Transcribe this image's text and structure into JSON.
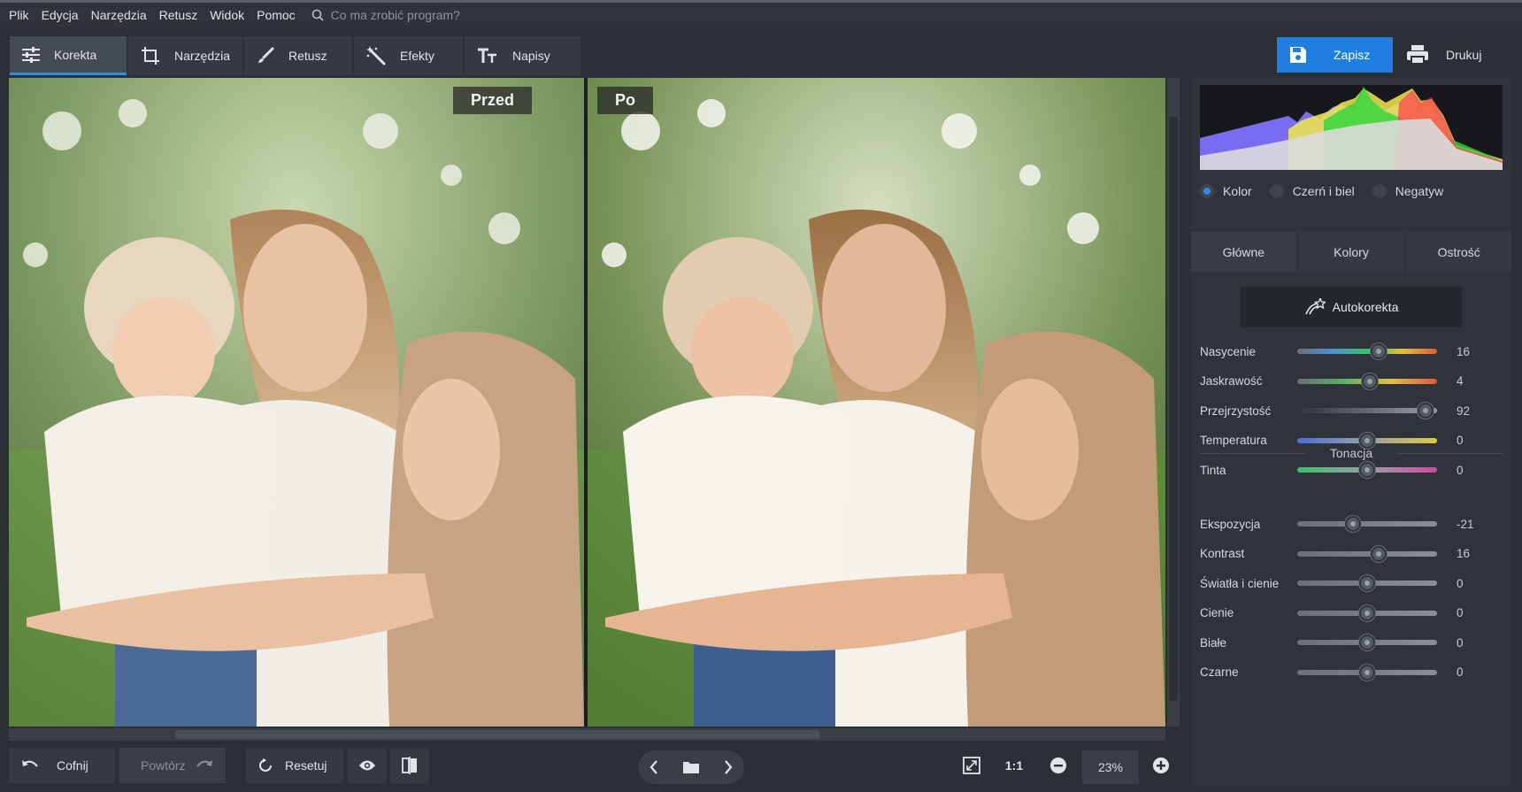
{
  "menu": {
    "items": [
      "Plik",
      "Edycja",
      "Narzędzia",
      "Retusz",
      "Widok",
      "Pomoc"
    ],
    "search_placeholder": "Co ma zrobić program?"
  },
  "toolbar": {
    "tabs": [
      {
        "label": "Korekta",
        "icon": "sliders-icon",
        "active": true
      },
      {
        "label": "Narzędzia",
        "icon": "crop-icon",
        "active": false
      },
      {
        "label": "Retusz",
        "icon": "brush-icon",
        "active": false
      },
      {
        "label": "Efekty",
        "icon": "magic-wand-icon",
        "active": false
      },
      {
        "label": "Napisy",
        "icon": "text-icon",
        "active": false
      }
    ],
    "save_label": "Zapisz",
    "print_label": "Drukuj"
  },
  "preview": {
    "before_label": "Przed",
    "after_label": "Po"
  },
  "panel": {
    "color_modes": [
      {
        "label": "Kolor",
        "selected": true
      },
      {
        "label": "Czerń i biel",
        "selected": false
      },
      {
        "label": "Negatyw",
        "selected": false
      }
    ],
    "tabs": [
      "Główne",
      "Kolory",
      "Ostrość"
    ],
    "active_tab": "Główne",
    "auto_label": "Autokorekta",
    "main_sliders": [
      {
        "label": "Nasycenie",
        "value": "16",
        "level": 0.58,
        "gradient": "saturation"
      },
      {
        "label": "Jaskrawość",
        "value": "4",
        "level": 0.52,
        "gradient": "vibrance"
      },
      {
        "label": "Przejrzystość",
        "value": "92",
        "level": 0.92,
        "gradient": "clarity"
      },
      {
        "label": "Temperatura",
        "value": "0",
        "level": 0.5,
        "gradient": "temperature"
      },
      {
        "label": "Tinta",
        "value": "0",
        "level": 0.5,
        "gradient": "tint"
      }
    ],
    "tone_title": "Tonacja",
    "tone_sliders": [
      {
        "label": "Ekspozycja",
        "value": "-21",
        "level": 0.4
      },
      {
        "label": "Kontrast",
        "value": "16",
        "level": 0.58
      },
      {
        "label": "Światła i cienie",
        "value": "0",
        "level": 0.5
      },
      {
        "label": "Cienie",
        "value": "0",
        "level": 0.5
      },
      {
        "label": "Białe",
        "value": "0",
        "level": 0.5
      },
      {
        "label": "Czarne",
        "value": "0",
        "level": 0.5
      }
    ]
  },
  "bottom": {
    "undo_label": "Cofnij",
    "redo_label": "Powtórz",
    "reset_label": "Resetuj",
    "ratio_label": "1:1",
    "zoom_value": "23%"
  },
  "colors": {
    "accent": "#1e7fe0",
    "background": "#2b2f36",
    "panel": "#2f333a"
  }
}
